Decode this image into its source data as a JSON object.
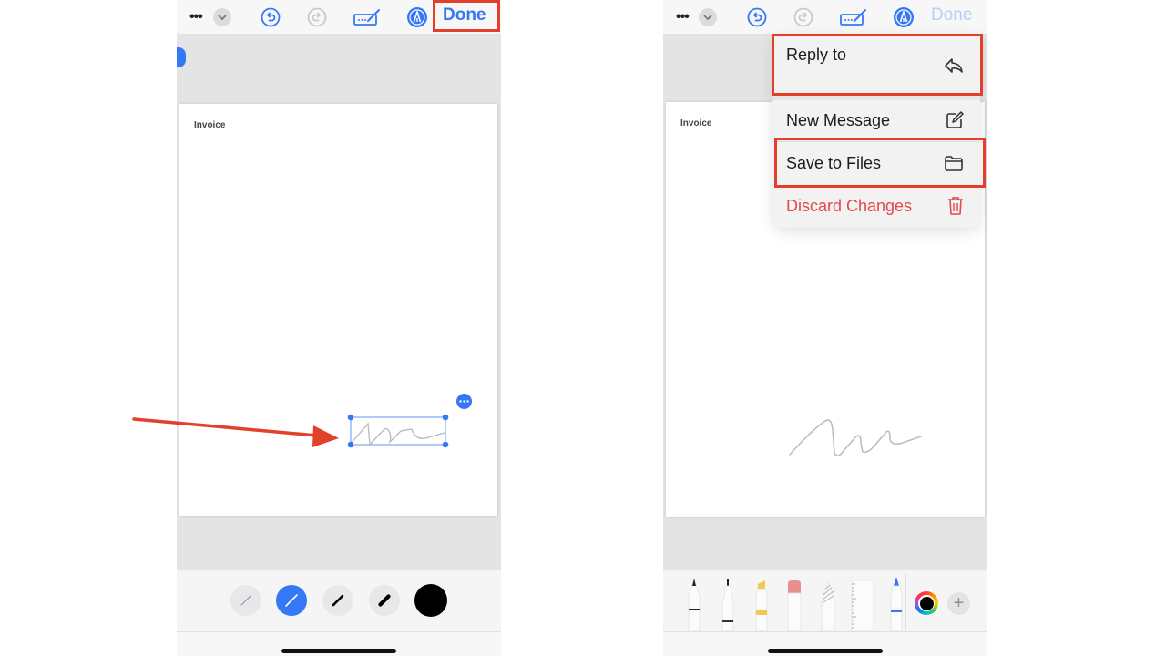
{
  "left_screen": {
    "topbar": {
      "more_label": "•••",
      "done_label": "Done",
      "icons": [
        "more-icon",
        "chevron-down-icon",
        "undo-icon",
        "redo-icon",
        "signature-icon",
        "markup-pen-icon"
      ]
    },
    "document": {
      "title": "Invoice"
    },
    "signature": {
      "selected": true,
      "options_icon": "more-options-icon"
    },
    "stroke_widths": {
      "options": [
        "thin",
        "medium",
        "thick",
        "extra-thick"
      ],
      "selected": "medium",
      "color": "#000000"
    },
    "annotation": {
      "arrow_color": "#e3402b",
      "highlight_target": "done-button"
    }
  },
  "right_screen": {
    "topbar": {
      "more_label": "•••",
      "done_label": "Done"
    },
    "document": {
      "title": "Invoice"
    },
    "menu": {
      "items": [
        {
          "label": "Reply to",
          "sublabel": "",
          "icon": "reply-icon",
          "highlighted": true
        },
        {
          "label": "New Message",
          "icon": "compose-icon",
          "highlighted": false
        },
        {
          "label": "Save to Files",
          "icon": "folder-icon",
          "highlighted": true
        },
        {
          "label": "Discard Changes",
          "icon": "trash-icon",
          "highlighted": false,
          "destructive": true
        }
      ]
    },
    "tools": [
      "pen",
      "fineliner",
      "highlighter",
      "eraser",
      "pencil",
      "ruler",
      "marker",
      "color-picker",
      "add"
    ],
    "selected_color": "#000000",
    "add_label": "+"
  },
  "colors": {
    "accent": "#3478f6",
    "annotation_red": "#e3402b",
    "danger": "#e5484d"
  }
}
